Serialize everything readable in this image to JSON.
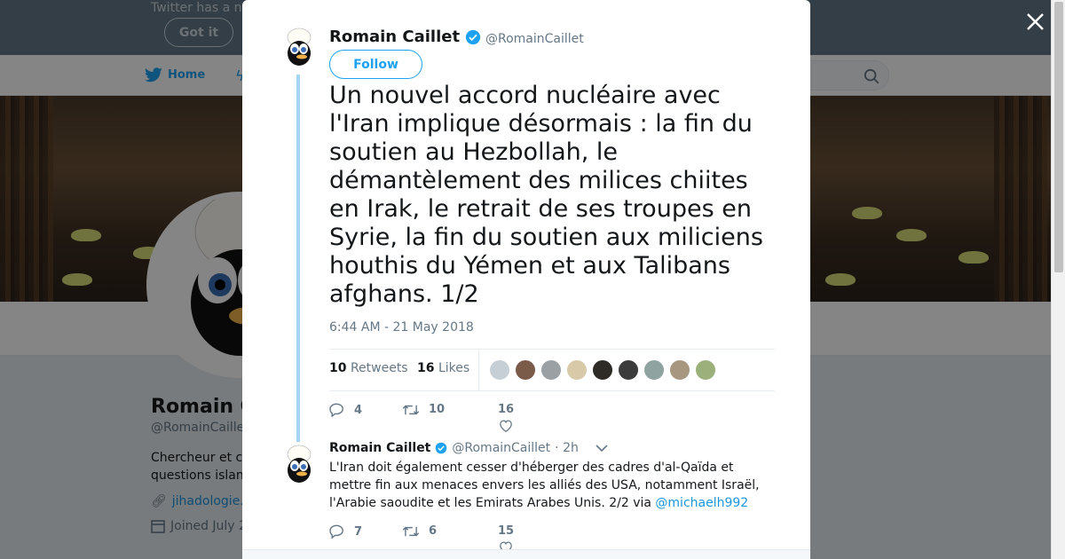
{
  "banner": {
    "text": "Twitter has a n",
    "got_it_label": "Got it"
  },
  "nav": {
    "home_label": "Home"
  },
  "profile": {
    "name": "Romain C",
    "handle": "@RomainCaille",
    "bio_line1": "Chercheur et c",
    "bio_line2": "questions islan",
    "link": "jihadologie.",
    "joined": "Joined July 2"
  },
  "tweet1": {
    "name": "Romain Caillet",
    "handle": "@RomainCaillet",
    "follow_label": "Follow",
    "text": "Un nouvel accord nucléaire avec l'Iran implique désormais : la fin du soutien au Hezbollah, le démantèlement des milices chiites en Irak, le retrait de ses troupes en Syrie, la fin du soutien aux miliciens houthis du Yémen et aux Talibans afghans. 1/2",
    "timestamp": "6:44 AM - 21 May 2018",
    "retweets_count": "10",
    "retweets_label": "Retweets",
    "likes_count": "16",
    "likes_label": "Likes",
    "replies": "4",
    "retweets": "10",
    "likes": "16",
    "liker_colors": [
      "#c7cfd6",
      "#7a5a48",
      "#9aa0a3",
      "#d8c9a8",
      "#2e2a26",
      "#3b3b3b",
      "#8fa3a1",
      "#a79680",
      "#9bb07a"
    ]
  },
  "tweet2": {
    "name": "Romain Caillet",
    "handle": "@RomainCaillet",
    "time": "· 2h",
    "text": "L'Iran doit également cesser d'héberger des cadres d'al-Qaïda et mettre fin aux menaces envers les alliés des USA, notamment Israël, l'Arabie saoudite et les Emirats Arabes Unis. 2/2 via ",
    "mention": "@michaelh992",
    "replies": "7",
    "retweets": "6",
    "likes": "15"
  },
  "colors": {
    "accent": "#1da1f2",
    "verified": "#1da1f2",
    "thread_line": "#a5d4f5"
  }
}
